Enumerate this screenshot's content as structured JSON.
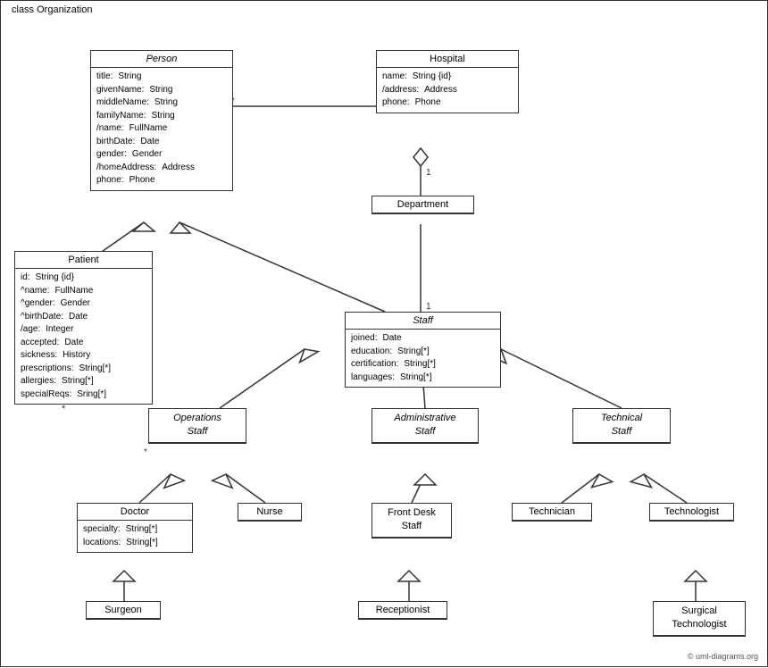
{
  "diagram_title": "class Organization",
  "classes": {
    "person": {
      "name": "Person",
      "italic": true,
      "attributes": [
        {
          "name": "title:",
          "type": "String"
        },
        {
          "name": "givenName:",
          "type": "String"
        },
        {
          "name": "middleName:",
          "type": "String"
        },
        {
          "name": "familyName:",
          "type": "String"
        },
        {
          "name": "/name:",
          "type": "FullName"
        },
        {
          "name": "birthDate:",
          "type": "Date"
        },
        {
          "name": "gender:",
          "type": "Gender"
        },
        {
          "name": "/homeAddress:",
          "type": "Address"
        },
        {
          "name": "phone:",
          "type": "Phone"
        }
      ]
    },
    "hospital": {
      "name": "Hospital",
      "italic": false,
      "attributes": [
        {
          "name": "name:",
          "type": "String {id}"
        },
        {
          "name": "/address:",
          "type": "Address"
        },
        {
          "name": "phone:",
          "type": "Phone"
        }
      ]
    },
    "patient": {
      "name": "Patient",
      "italic": false,
      "attributes": [
        {
          "name": "id:",
          "type": "String {id}"
        },
        {
          "name": "^name:",
          "type": "FullName"
        },
        {
          "name": "^gender:",
          "type": "Gender"
        },
        {
          "name": "^birthDate:",
          "type": "Date"
        },
        {
          "name": "/age:",
          "type": "Integer"
        },
        {
          "name": "accepted:",
          "type": "Date"
        },
        {
          "name": "sickness:",
          "type": "History"
        },
        {
          "name": "prescriptions:",
          "type": "String[*]"
        },
        {
          "name": "allergies:",
          "type": "String[*]"
        },
        {
          "name": "specialReqs:",
          "type": "Sring[*]"
        }
      ]
    },
    "department": {
      "name": "Department",
      "italic": false,
      "attributes": []
    },
    "staff": {
      "name": "Staff",
      "italic": true,
      "attributes": [
        {
          "name": "joined:",
          "type": "Date"
        },
        {
          "name": "education:",
          "type": "String[*]"
        },
        {
          "name": "certification:",
          "type": "String[*]"
        },
        {
          "name": "languages:",
          "type": "String[*]"
        }
      ]
    },
    "operations_staff": {
      "name": "Operations\nStaff",
      "italic": true,
      "attributes": []
    },
    "administrative_staff": {
      "name": "Administrative\nStaff",
      "italic": true,
      "attributes": []
    },
    "technical_staff": {
      "name": "Technical\nStaff",
      "italic": true,
      "attributes": []
    },
    "doctor": {
      "name": "Doctor",
      "italic": false,
      "attributes": [
        {
          "name": "specialty:",
          "type": "String[*]"
        },
        {
          "name": "locations:",
          "type": "String[*]"
        }
      ]
    },
    "nurse": {
      "name": "Nurse",
      "italic": false,
      "attributes": []
    },
    "front_desk_staff": {
      "name": "Front Desk\nStaff",
      "italic": false,
      "attributes": []
    },
    "technician": {
      "name": "Technician",
      "italic": false,
      "attributes": []
    },
    "technologist": {
      "name": "Technologist",
      "italic": false,
      "attributes": []
    },
    "surgeon": {
      "name": "Surgeon",
      "italic": false,
      "attributes": []
    },
    "receptionist": {
      "name": "Receptionist",
      "italic": false,
      "attributes": []
    },
    "surgical_technologist": {
      "name": "Surgical\nTechnologist",
      "italic": false,
      "attributes": []
    }
  },
  "copyright": "© uml-diagrams.org",
  "multiplicity": {
    "star": "*",
    "one": "1"
  }
}
